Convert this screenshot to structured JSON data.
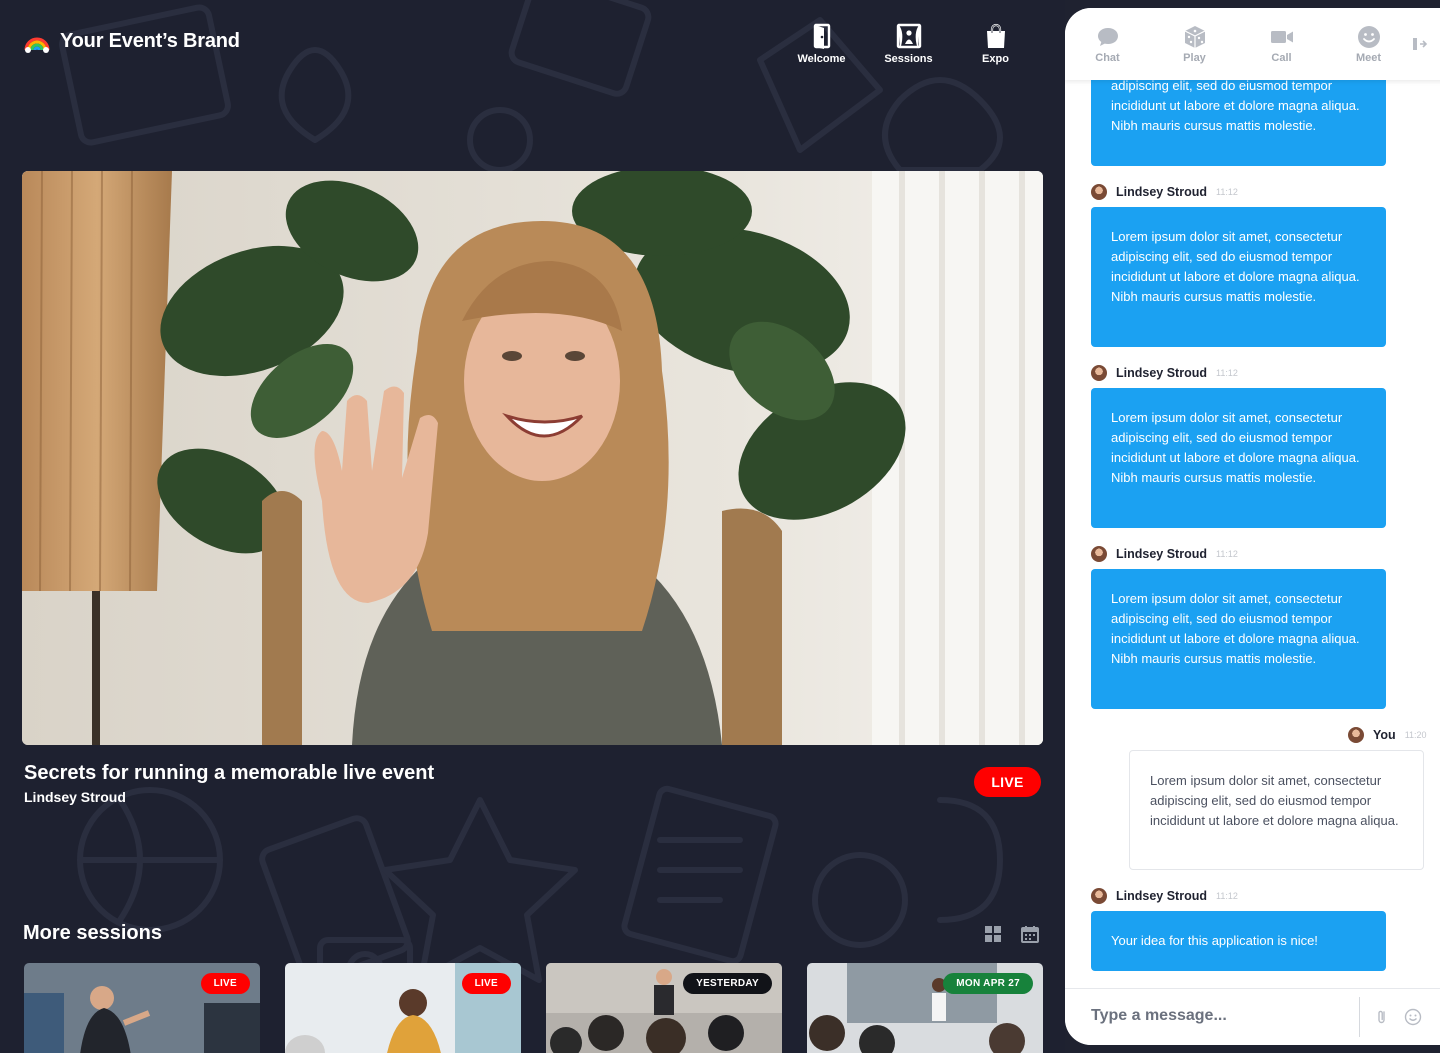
{
  "brand": {
    "name": "Your Event’s Brand",
    "logo_icon": "rainbow-icon"
  },
  "topnav": [
    {
      "label": "Welcome",
      "icon": "door-icon"
    },
    {
      "label": "Sessions",
      "icon": "stage-icon"
    },
    {
      "label": "Expo",
      "icon": "shopping-bag-icon"
    }
  ],
  "featured": {
    "title": "Secrets for running a memorable live event",
    "speaker": "Lindsey Stroud",
    "status": "LIVE"
  },
  "more_sessions": {
    "heading": "More sessions",
    "cards": [
      {
        "badge": "LIVE"
      },
      {
        "badge": "LIVE"
      },
      {
        "badge": "YESTERDAY"
      },
      {
        "badge": "MON APR 27"
      }
    ]
  },
  "chat": {
    "tabs": [
      {
        "label": "Chat",
        "icon": "chat-bubble-icon"
      },
      {
        "label": "Play",
        "icon": "dice-icon"
      },
      {
        "label": "Call",
        "icon": "video-camera-icon"
      },
      {
        "label": "Meet",
        "icon": "smiley-icon"
      }
    ],
    "top_message_text": "adipiscing elit, sed do eiusmod tempor incididunt ut labore et dolore magna aliqua. Nibh mauris cursus mattis molestie.",
    "messages": [
      {
        "author": "Lindsey Stroud",
        "time": "11:12",
        "text": "Lorem ipsum dolor sit amet, consectetur adipiscing elit, sed do eiusmod tempor incididunt ut labore et dolore magna aliqua. Nibh mauris cursus mattis molestie."
      },
      {
        "author": "Lindsey Stroud",
        "time": "11:12",
        "text": "Lorem ipsum dolor sit amet, consectetur adipiscing elit, sed do eiusmod tempor incididunt ut labore et dolore magna aliqua. Nibh mauris cursus mattis molestie."
      },
      {
        "author": "Lindsey Stroud",
        "time": "11:12",
        "text": "Lorem ipsum dolor sit amet, consectetur adipiscing elit, sed do eiusmod tempor incididunt ut labore et dolore magna aliqua. Nibh mauris cursus mattis molestie."
      },
      {
        "author": "You",
        "time": "11:20",
        "text": "Lorem ipsum dolor sit amet, consectetur adipiscing elit, sed do eiusmod tempor incididunt ut labore et dolore magna aliqua."
      },
      {
        "author": "Lindsey Stroud",
        "time": "11:12",
        "text": "Your idea for this application is nice!"
      }
    ],
    "composer_placeholder": "Type a message..."
  },
  "colors": {
    "background": "#1e2130",
    "accent_blue": "#1ba1f2",
    "live_red": "#ff0000",
    "date_green": "#17823b"
  }
}
